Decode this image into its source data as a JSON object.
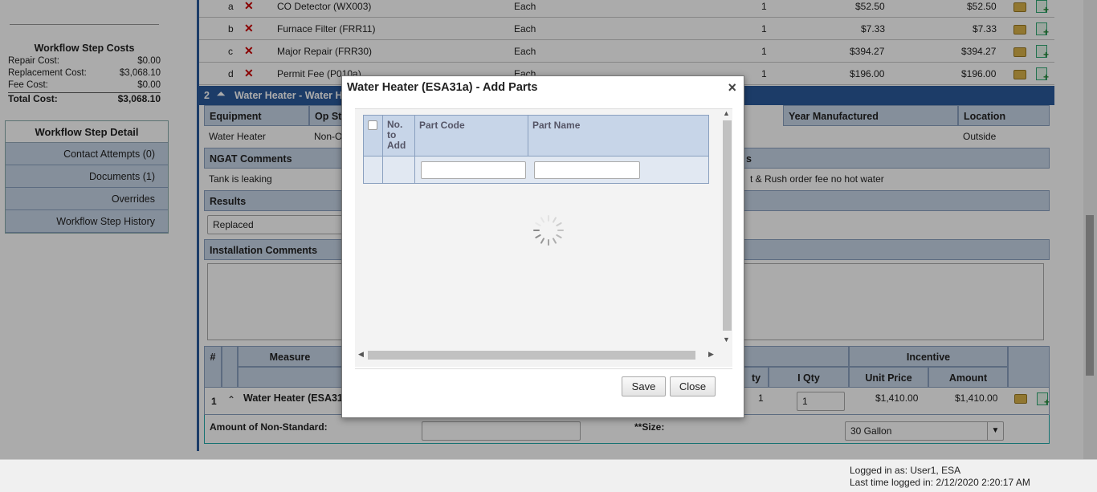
{
  "sidebar": {
    "costs_title": "Workflow Step Costs",
    "costs": [
      {
        "label": "Repair Cost:",
        "value": "$0.00"
      },
      {
        "label": "Replacement Cost:",
        "value": "$3,068.10"
      },
      {
        "label": "Fee Cost:",
        "value": "$0.00"
      }
    ],
    "total_label": "Total Cost:",
    "total_value": "$3,068.10",
    "active_tab": "Workflow Step Detail",
    "nav_items": [
      "Contact Attempts (0)",
      "Documents (1)",
      "Overrides",
      "Workflow Step History"
    ]
  },
  "parts_rows": [
    {
      "letter": "a",
      "name": "CO Detector (WX003)",
      "unit": "Each",
      "qty": "1",
      "price": "$52.50",
      "amount": "$52.50"
    },
    {
      "letter": "b",
      "name": "Furnace Filter (FRR11)",
      "unit": "Each",
      "qty": "1",
      "price": "$7.33",
      "amount": "$7.33"
    },
    {
      "letter": "c",
      "name": "Major Repair (FRR30)",
      "unit": "Each",
      "qty": "1",
      "price": "$394.27",
      "amount": "$394.27"
    },
    {
      "letter": "d",
      "name": "Permit Fee (P010a)",
      "unit": "Each",
      "qty": "1",
      "price": "$196.00",
      "amount": "$196.00"
    }
  ],
  "section": {
    "number": "2",
    "title": "Water Heater - Water H",
    "equipment_label": "Equipment",
    "op_status_label": "Op Sta",
    "year_label": "Year Manufactured",
    "location_label": "Location",
    "equipment_value": "Water Heater",
    "op_status_value": "Non-Op",
    "location_value": "Outside",
    "ngat_label": "NGAT Comments",
    "ngat_value": "Tank is leaking",
    "right_label_fragment": "s",
    "right_value_fragment": "t & Rush order fee no hot water",
    "results_label": "Results",
    "results_value": "Replaced",
    "install_label": "Installation Comments"
  },
  "measure_grid": {
    "hash": "#",
    "measure": "Measure",
    "incentive": "Incentive",
    "qty_frag": "ty",
    "iqty": "I Qty",
    "unit_price": "Unit Price",
    "amount": "Amount",
    "row_num": "1",
    "row_name": "Water Heater (ESA31",
    "row_qty": "1",
    "row_iqty": "1",
    "row_unit_price": "$1,410.00",
    "row_amount": "$1,410.00",
    "non_standard_label": "Amount of Non-Standard:",
    "size_label": "**Size:",
    "size_value": "30 Gallon"
  },
  "dialog": {
    "title": "Water Heater (ESA31a) - Add Parts",
    "col_no_to_add": "No. to Add",
    "col_part_code": "Part Code",
    "col_part_name": "Part Name",
    "save_label": "Save",
    "close_label": "Close"
  },
  "footer": {
    "logged_in": "Logged in as: User1, ESA",
    "last_login": "Last time logged in: 2/12/2020 2:20:17 AM"
  }
}
